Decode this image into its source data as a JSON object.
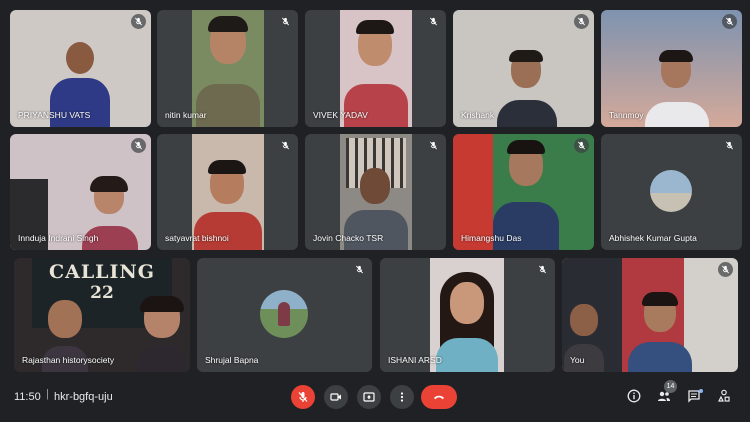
{
  "participants": [
    {
      "name": "PRIYANSHU VATS"
    },
    {
      "name": "nitin kumar"
    },
    {
      "name": "VIVEK YADAV"
    },
    {
      "name": "Krishank"
    },
    {
      "name": "Tannmoy"
    },
    {
      "name": "Innduja Indrani Singh"
    },
    {
      "name": "satyavrat bishnoi"
    },
    {
      "name": "Jovin Chacko TSR"
    },
    {
      "name": "Himangshu Das"
    },
    {
      "name": "Abhishek Kumar Gupta"
    },
    {
      "name": "Rajasthan historysociety"
    },
    {
      "name": "Shrujal Bapna"
    },
    {
      "name": "ISHANI ARSD"
    },
    {
      "name": "You"
    }
  ],
  "banner_text": {
    "line1": "CALLING",
    "line2": "22"
  },
  "bottom_bar": {
    "time": "11:50",
    "separator": "|",
    "meeting_code": "hkr-bgfq-uju",
    "participant_count": "14"
  },
  "colors": {
    "background": "#202124",
    "tile": "#3c4043",
    "end_call": "#ea4335",
    "accent": "#8ab4f8"
  },
  "icons": [
    "mic-off-icon",
    "camera-icon",
    "present-icon",
    "more-vert-icon",
    "call-end-icon",
    "info-icon",
    "people-icon",
    "chat-icon",
    "activities-icon"
  ]
}
